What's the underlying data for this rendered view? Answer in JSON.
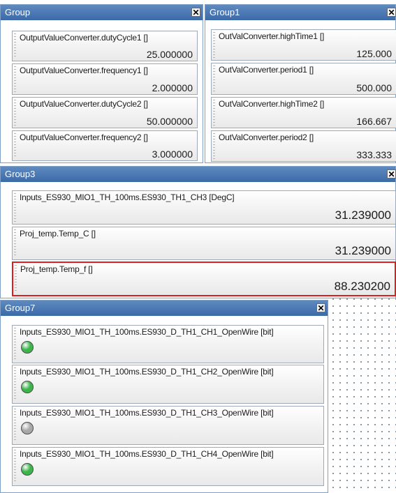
{
  "group": {
    "title": "Group",
    "items": [
      {
        "label": "OutputValueConverter.dutyCycle1 []",
        "value": "25.000000"
      },
      {
        "label": "OutputValueConverter.frequency1 []",
        "value": "2.000000"
      },
      {
        "label": "OutputValueConverter.dutyCycle2 []",
        "value": "50.000000"
      },
      {
        "label": "OutputValueConverter.frequency2 []",
        "value": "3.000000"
      }
    ]
  },
  "group1": {
    "title": "Group1",
    "items": [
      {
        "label": "OutValConverter.highTime1 []",
        "value": "125.000"
      },
      {
        "label": "OutValConverter.period1 []",
        "value": "500.000"
      },
      {
        "label": "OutValConverter.highTime2 []",
        "value": "166.667"
      },
      {
        "label": "OutValConverter.period2 []",
        "value": "333.333"
      }
    ]
  },
  "group3": {
    "title": "Group3",
    "items": [
      {
        "label": "Inputs_ES930_MIO1_TH_100ms.ES930_TH1_CH3 [DegC]",
        "value": "31.239000"
      },
      {
        "label": "Proj_temp.Temp_C []",
        "value": "31.239000"
      },
      {
        "label": "Proj_temp.Temp_f []",
        "value": "88.230200"
      }
    ]
  },
  "group7": {
    "title": "Group7",
    "items": [
      {
        "label": "Inputs_ES930_MIO1_TH_100ms.ES930_D_TH1_CH1_OpenWire [bit]",
        "state": "green"
      },
      {
        "label": "Inputs_ES930_MIO1_TH_100ms.ES930_D_TH1_CH2_OpenWire [bit]",
        "state": "green"
      },
      {
        "label": "Inputs_ES930_MIO1_TH_100ms.ES930_D_TH1_CH3_OpenWire [bit]",
        "state": "gray"
      },
      {
        "label": "Inputs_ES930_MIO1_TH_100ms.ES930_D_TH1_CH4_OpenWire [bit]",
        "state": "green"
      }
    ]
  },
  "close_symbol": "✕",
  "colors": {
    "led_green": "#3cb54a",
    "led_gray": "#a8a8a8",
    "selected_border": "#e21c1c"
  }
}
